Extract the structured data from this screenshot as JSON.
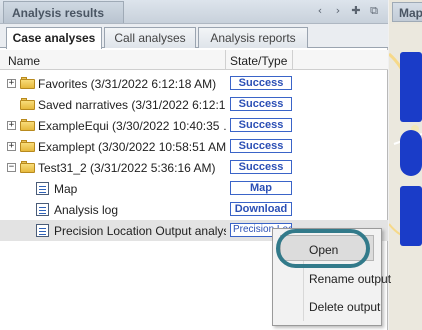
{
  "panel": {
    "title": "Analysis results",
    "header_icons": [
      "chevron-left-icon",
      "chevron-right-icon",
      "pin-icon",
      "restore-icon"
    ],
    "header_glyphs": [
      "‹",
      "›",
      "✚",
      "⧉"
    ]
  },
  "tabs": [
    {
      "label": "Case analyses",
      "active": true
    },
    {
      "label": "Call analyses",
      "active": false
    },
    {
      "label": "Analysis reports",
      "active": false
    }
  ],
  "columns": {
    "name": "Name",
    "state_type": "State/Type"
  },
  "tree": [
    {
      "label": "Favorites (3/31/2022 6:12:18 AM)",
      "state": "Success",
      "type": "folder",
      "expanded": false
    },
    {
      "label": "Saved narratives (3/31/2022 6:12:1…",
      "state": "Success",
      "type": "folder",
      "expanded": null
    },
    {
      "label": "ExampleEqui (3/30/2022 10:40:35 …",
      "state": "Success",
      "type": "folder",
      "expanded": false
    },
    {
      "label": "Examplept (3/30/2022 10:58:51 AM)",
      "state": "Success",
      "type": "folder",
      "expanded": false
    },
    {
      "label": "Test31_2 (3/31/2022 5:36:16 AM)",
      "state": "Success",
      "type": "folder",
      "expanded": true
    },
    {
      "label": "Map",
      "state": "Map",
      "type": "output"
    },
    {
      "label": "Analysis log",
      "state": "Download",
      "type": "output"
    },
    {
      "label": "Precision Location Output analysis",
      "state": "Precision Loc",
      "type": "output",
      "selected": true
    }
  ],
  "expander_glyphs": {
    "collapsed": "+",
    "expanded": "−"
  },
  "map_tab": {
    "label": "Map"
  },
  "context_menu": {
    "items": [
      {
        "label": "Open",
        "highlighted": true
      },
      {
        "label": "Rename output"
      },
      {
        "label": "Delete output"
      }
    ]
  },
  "colors": {
    "accent": "#2b4fb5",
    "highlight_ring": "#327a8a",
    "nav_tool": "#1a3cc8"
  }
}
